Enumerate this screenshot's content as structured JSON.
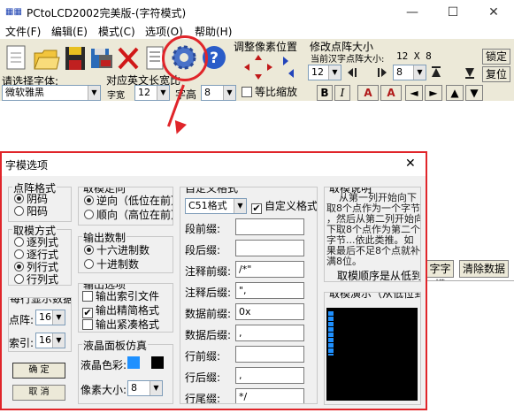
{
  "window": {
    "title": "PCtoLCD2002完美版-(字符模式)",
    "min_glyph": "—",
    "max_glyph": "☐",
    "close_glyph": "✕"
  },
  "menu": [
    "文件(F)",
    "编辑(E)",
    "模式(C)",
    "选项(O)",
    "帮助(H)"
  ],
  "toolbar": {
    "font_label": "请选择字体:",
    "font_value": "微软雅黑",
    "width_group_label": "对应英文长宽比",
    "char_width_label": "字宽",
    "char_width_value": "12",
    "char_height_label": "字高",
    "char_height_value": "8",
    "proportional_label": "等比缩放",
    "adjust_pixel_label": "调整像素位置",
    "modify_size_label": "修改点阵大小",
    "current_size_label": "当前汉字点阵大小:",
    "current_size_value": "12 X 8",
    "spin1_value": "12",
    "spin2_value": "8",
    "lock_button": "锁定",
    "restore_button": "复位",
    "bold_button": "B",
    "italic_button": "I",
    "font_ctrl_a1": "A",
    "font_ctrl_a2": "A"
  },
  "right_panel": {
    "generate_button": "字字模",
    "clear_button": "清除数据"
  },
  "dialog": {
    "title": "字模选项",
    "close_glyph": "✕",
    "dot_format": {
      "legend": "点阵格式",
      "options": [
        "阴码",
        "阳码"
      ],
      "selected": 0
    },
    "take_mode": {
      "legend": "取模方式",
      "options": [
        "逐列式",
        "逐行式",
        "列行式",
        "行列式"
      ],
      "selected": 2
    },
    "per_line": {
      "legend": "每行显示数据",
      "dot_label": "点阵:",
      "dot_value": "16",
      "index_label": "索引:",
      "index_value": "16"
    },
    "ok_button": "确  定",
    "cancel_button": "取  消",
    "direction": {
      "legend": "取模走向",
      "options": [
        "逆向（低位在前）",
        "顺向（高位在前）"
      ],
      "selected": 0
    },
    "output_base": {
      "legend": "输出数制",
      "options": [
        "十六进制数",
        "十进制数"
      ],
      "selected": 0
    },
    "output_options": {
      "legend": "输出选项",
      "items": [
        {
          "label": "输出索引文件",
          "checked": false
        },
        {
          "label": "输出精简格式",
          "checked": true
        },
        {
          "label": "输出紧凑格式",
          "checked": false
        }
      ]
    },
    "lcd_panel": {
      "legend": "液晶面板仿真",
      "color_label": "液晶色彩:",
      "pixel_label": "像素大小:",
      "pixel_value": "8"
    },
    "custom_format": {
      "legend": "自定义格式",
      "format_value": "C51格式",
      "custom_check_label": "自定义格式",
      "rows": [
        {
          "label": "段前缀:",
          "value": ""
        },
        {
          "label": "段后缀:",
          "value": ""
        },
        {
          "label": "注释前缀:",
          "value": "/*\""
        },
        {
          "label": "注释后缀:",
          "value": "\","
        },
        {
          "label": "数据前缀:",
          "value": "0x"
        },
        {
          "label": "数据后缀:",
          "value": ","
        },
        {
          "label": "行前缀:",
          "value": ""
        },
        {
          "label": "行后缀:",
          "value": ","
        },
        {
          "label": "行尾缀:",
          "value": "*/"
        }
      ]
    },
    "explain": {
      "legend": "取模说明",
      "lines": [
        "从第一列开始向下",
        "取8个点作为一个字节",
        "，然后从第二列开始向",
        "下取8个点作为第二个",
        "字节...依此类推。如",
        "果最后不足8个点就补",
        "满8位。"
      ],
      "order_label": "取模顺序是从低到高"
    },
    "demo_legend": "取模演示（从低位到高位）"
  }
}
